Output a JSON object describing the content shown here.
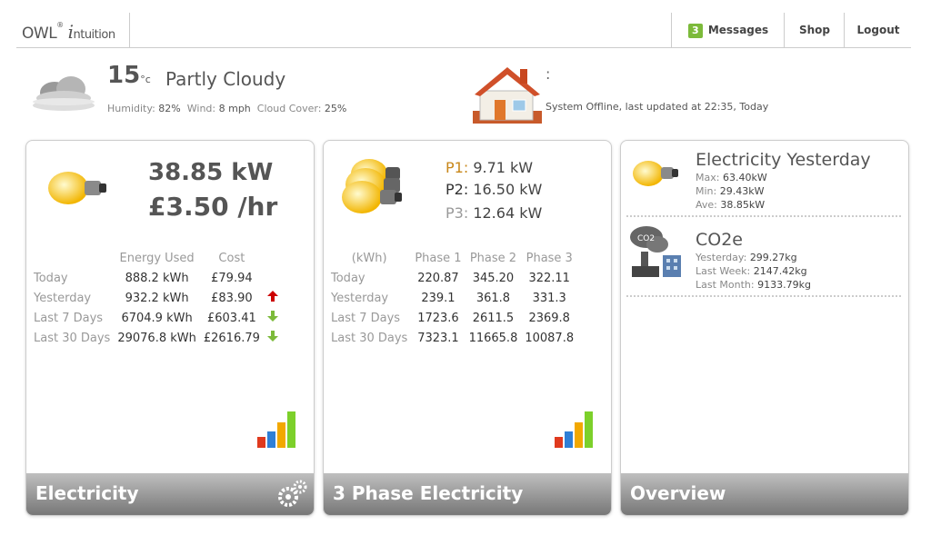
{
  "header": {
    "logo_owl": "OWL",
    "logo_i": "i",
    "logo_rest": "ntuition",
    "messages_count": "3",
    "messages_label": "Messages",
    "shop_label": "Shop",
    "logout_label": "Logout"
  },
  "weather": {
    "temp": "15",
    "unit": "°c",
    "condition": "Partly Cloudy",
    "humidity_label": "Humidity:",
    "humidity": "82%",
    "wind_label": "Wind:",
    "wind": "8 mph",
    "cloud_label": "Cloud Cover:",
    "cloud": "25%"
  },
  "system": {
    "colon": ":",
    "status": "System Offline, last updated at 22:35, Today"
  },
  "electricity": {
    "power": "38.85 kW",
    "rate": "£3.50 /hr",
    "col_energy": "Energy Used",
    "col_cost": "Cost",
    "rows": [
      {
        "label": "Today",
        "energy": "888.2 kWh",
        "cost": "£79.94",
        "trend": ""
      },
      {
        "label": "Yesterday",
        "energy": "932.2 kWh",
        "cost": "£83.90",
        "trend": "up"
      },
      {
        "label": "Last 7 Days",
        "energy": "6704.9 kWh",
        "cost": "£603.41",
        "trend": "down"
      },
      {
        "label": "Last 30 Days",
        "energy": "29076.8 kWh",
        "cost": "£2616.79",
        "trend": "down"
      }
    ],
    "footer": "Electricity"
  },
  "phase": {
    "p1_label": "P1:",
    "p1": "9.71 kW",
    "p2_label": "P2:",
    "p2": "16.50 kW",
    "p3_label": "P3:",
    "p3": "12.64 kW",
    "col_unit": "(kWh)",
    "col_1": "Phase 1",
    "col_2": "Phase 2",
    "col_3": "Phase 3",
    "rows": [
      {
        "label": "Today",
        "p1": "220.87",
        "p2": "345.20",
        "p3": "322.11"
      },
      {
        "label": "Yesterday",
        "p1": "239.1",
        "p2": "361.8",
        "p3": "331.3"
      },
      {
        "label": "Last 7 Days",
        "p1": "1723.6",
        "p2": "2611.5",
        "p3": "2369.8"
      },
      {
        "label": "Last 30 Days",
        "p1": "7323.1",
        "p2": "11665.8",
        "p3": "10087.8"
      }
    ],
    "footer": "3 Phase Electricity"
  },
  "overview": {
    "elec_title": "Electricity Yesterday",
    "max_label": "Max:",
    "max": "63.40kW",
    "min_label": "Min:",
    "min": "29.43kW",
    "ave_label": "Ave:",
    "ave": "38.85kW",
    "co2_title": "CO2e",
    "co2_icon_text": "CO2",
    "yest_label": "Yesterday:",
    "yest": "299.27kg",
    "week_label": "Last Week:",
    "week": "2147.42kg",
    "month_label": "Last Month:",
    "month": "9133.79kg",
    "footer": "Overview"
  },
  "colors": {
    "up_arrow": "#cc0000",
    "down_arrow": "#7cba3a",
    "p1": "#c8871a",
    "accent": "#7cba3a"
  }
}
